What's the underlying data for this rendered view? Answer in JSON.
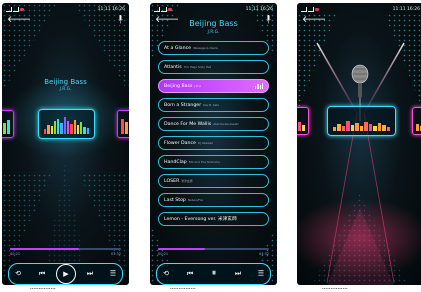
{
  "status": {
    "left": "3G 4G",
    "right": "11:11 16:26"
  },
  "screen1": {
    "song_title": "Beijing Bass",
    "artist": "J.R.G.",
    "time_current": "00:21",
    "time_total": "03:32",
    "progress": 0.62,
    "eq_levels": [
      0.3,
      0.5,
      0.45,
      0.7,
      0.85,
      0.6,
      0.95,
      0.75,
      0.55,
      0.8,
      0.5,
      0.65,
      0.4,
      0.35
    ]
  },
  "screen2": {
    "title": "Beijing Bass",
    "artist": "J.R.G.",
    "time_current": "00:21",
    "time_total": "03:32",
    "progress": 0.42,
    "songs": [
      {
        "title": "At a Glance",
        "artist": "Wessage & Deola",
        "active": false
      },
      {
        "title": "Atlantis",
        "artist": "Tim Haga Sixty Hall",
        "active": false
      },
      {
        "title": "Beijing Bass",
        "artist": "J.R.G",
        "active": true
      },
      {
        "title": "Born a Stranger",
        "artist": "Kav B. Sets",
        "active": false
      },
      {
        "title": "Dance For Me Wallis",
        "artist": "Abel Korzeniowski",
        "active": false
      },
      {
        "title": "Flower Dance",
        "artist": "DJ Okawari",
        "active": false
      },
      {
        "title": "HandClap",
        "artist": "Fitz And The Tantrums",
        "active": false
      },
      {
        "title": "LOSER",
        "artist": "米津玄師",
        "active": false
      },
      {
        "title": "Last Stop",
        "artist": "Nelson/Fox",
        "active": false
      },
      {
        "title": "Lemon - Eversong ver. 米津玄師",
        "artist": "",
        "active": false
      }
    ]
  },
  "screen3": {
    "eq_levels": [
      0.25,
      0.4,
      0.3,
      0.55,
      0.35,
      0.45,
      0.3,
      0.5,
      0.4,
      0.3,
      0.45,
      0.35,
      0.25
    ]
  },
  "captions": [
    "...............",
    "...............",
    "..............."
  ],
  "colors": {
    "accent": "#3ee0ff",
    "purple": "#c93cff",
    "title": "#4cd6f0"
  }
}
